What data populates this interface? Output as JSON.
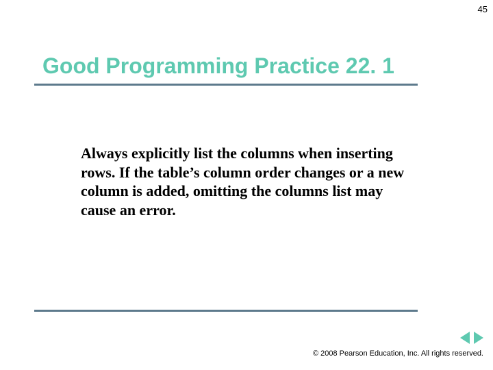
{
  "page_number": "45",
  "title": "Good Programming Practice 22. 1",
  "body": "Always explicitly list the columns when inserting rows. If the table’s column order changes or a new column is added, omitting the columns list may cause an error.",
  "copyright": "© 2008 Pearson Education, Inc. All rights reserved.",
  "colors": {
    "accent": "#5ec9b0",
    "rule": "#5d7a8c"
  }
}
